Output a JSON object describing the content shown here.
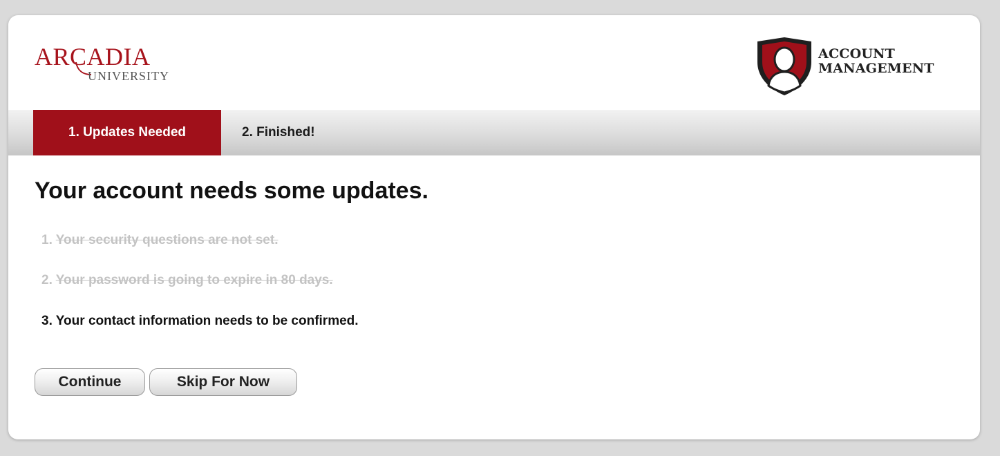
{
  "header": {
    "university_logo": {
      "name_line1": "ARCADIA",
      "name_line2": "UNIVERSITY",
      "brand_color": "#a7131c"
    },
    "product_logo": {
      "line1": "ACCOUNT",
      "line2": "MANAGEMENT",
      "icon": "shield-user-icon"
    }
  },
  "tabs": [
    {
      "label": "1. Updates Needed",
      "active": true
    },
    {
      "label": "2. Finished!",
      "active": false
    }
  ],
  "main": {
    "title": "Your account needs some updates.",
    "updates": [
      {
        "number": "1.",
        "text": "Your security questions are not set.",
        "completed": true
      },
      {
        "number": "2.",
        "text": "Your password is going to expire in 80 days.",
        "completed": true
      },
      {
        "number": "3.",
        "text": "Your contact information needs to be confirmed.",
        "completed": false
      }
    ]
  },
  "actions": {
    "continue_label": "Continue",
    "skip_label": "Skip For Now"
  },
  "colors": {
    "accent": "#a0101a",
    "completed_text": "#c3c3c3"
  }
}
